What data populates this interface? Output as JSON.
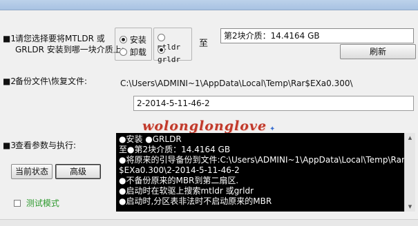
{
  "window": {
    "title": ""
  },
  "section1": {
    "number": "■1",
    "prompt_line1": "请您选择要将MTLDR 或",
    "prompt_line2": "GRLDR 安装到哪一块介质上:",
    "action_options": [
      {
        "label": "安装",
        "selected": true
      },
      {
        "label": "卸载",
        "selected": false
      }
    ],
    "loader_options": [
      {
        "label": "mtldr",
        "selected": false
      },
      {
        "label": "grldr",
        "selected": true
      }
    ],
    "to_label": "至",
    "target_disk_value": "第2块介质：14.4164 GB",
    "refresh_button": "刷新"
  },
  "section2": {
    "number": "■2",
    "label": "备份文件\\恢复文件:",
    "path": "C:\\Users\\ADMINI~1\\AppData\\Local\\Temp\\Rar$EXa0.300\\",
    "filename": "2-2014-5-11-46-2"
  },
  "section3": {
    "number": "■3",
    "label": "查看参数与执行:",
    "current_status_button": "当前状态",
    "advanced_button": "高级",
    "test_mode_label": "测试模式",
    "test_mode_checked": false,
    "output_lines": [
      "●安装 ●GRLDR",
      "至●第2块介质：14.4164 GB",
      "●将原来的引导备份到文件:C:\\Users\\ADMINI~1\\AppData\\Local\\Temp\\Rar",
      "$EXa0.300\\2-2014-5-11-46-2",
      "●不备份原来的MBR到第二扇区.",
      "●启动时在软驱上搜索mtldr 或grldr",
      "●启动时,分区表非法时不启动原来的MBR"
    ]
  },
  "watermark": "wolonglonglove",
  "colors": {
    "console_bg": "#000000",
    "console_text": "#ffffff",
    "test_mode": "#2e9a2e",
    "watermark": "#c0392b"
  }
}
